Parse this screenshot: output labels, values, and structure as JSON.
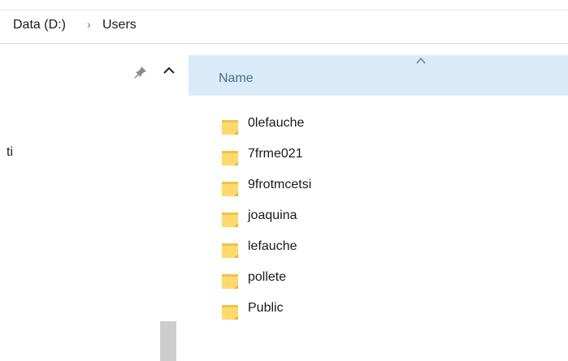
{
  "breadcrumb": {
    "drive": "Data (D:)",
    "folder": "Users",
    "separator": "›"
  },
  "nav": {
    "partial_item": "ti"
  },
  "column": {
    "name_label": "Name"
  },
  "folders": [
    {
      "name": "0lefauche"
    },
    {
      "name": "7frme021"
    },
    {
      "name": "9frotmcetsi"
    },
    {
      "name": "joaquina"
    },
    {
      "name": "lefauche"
    },
    {
      "name": "pollete"
    },
    {
      "name": "Public"
    }
  ],
  "colors": {
    "header_bg": "#d9ebf9",
    "folder_yellow": "#ffd96b",
    "folder_dark": "#e8b442"
  },
  "icons": {
    "pin": "pin-icon",
    "up": "chevron-up-icon",
    "folder": "folder-icon",
    "sort": "sort-ascending-icon"
  }
}
